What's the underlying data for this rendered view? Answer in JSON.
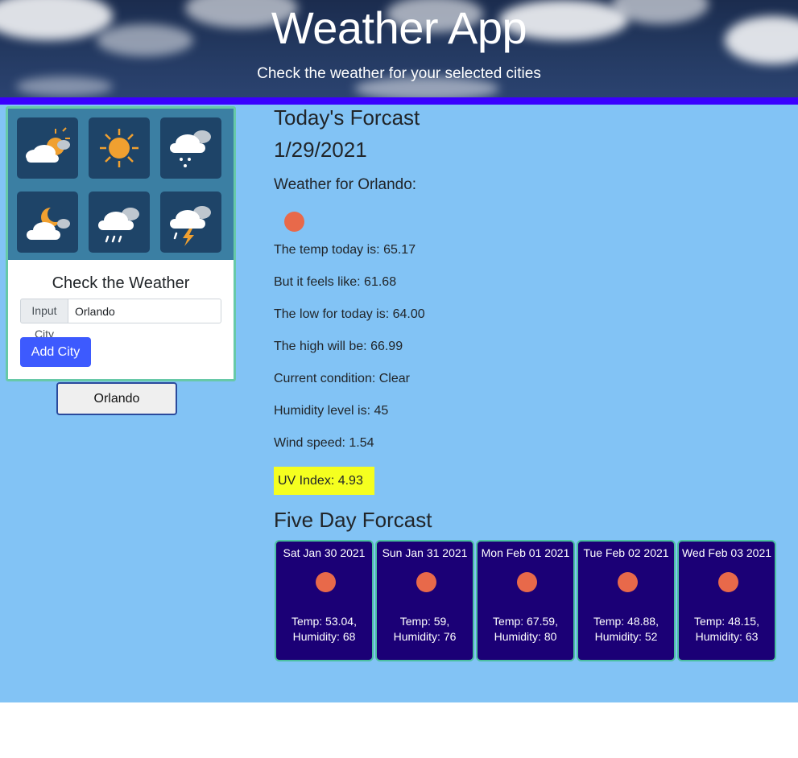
{
  "header": {
    "title": "Weather App",
    "subtitle": "Check the weather for your selected cities"
  },
  "colors": {
    "header_bar": "#3a00ff",
    "main_bg": "#82c3f5",
    "button": "#3d5afe",
    "uv_highlight": "#f5ff1f",
    "forecast_card": "#1b0076",
    "weather_icon": "#e8694a"
  },
  "sidebar": {
    "image_icons": [
      "partly-cloudy-day-icon",
      "sun-icon",
      "snow-cloud-icon",
      "partly-cloudy-night-icon",
      "rain-cloud-icon",
      "thunderstorm-icon"
    ],
    "card_title": "Check the Weather",
    "input_label": "Input City",
    "input_value": "Orlando",
    "add_button": "Add City",
    "saved_cities": [
      "Orlando"
    ]
  },
  "today": {
    "heading": "Today's Forcast",
    "date": "1/29/2021",
    "city_heading": "Weather for Orlando:",
    "icon": "weather-icon",
    "stats": [
      "The temp today is: 65.17",
      "But it feels like: 61.68",
      "The low for today is: 64.00",
      "The high will be: 66.99",
      "Current condition: Clear",
      "Humidity level is: 45",
      "Wind speed: 1.54"
    ],
    "uv_index": "UV Index: 4.93"
  },
  "forecast": {
    "heading": "Five Day Forcast",
    "days": [
      {
        "date": "Sat Jan 30 2021",
        "temp": "Temp: 53.04,",
        "humidity": "Humidity: 68"
      },
      {
        "date": "Sun Jan 31 2021",
        "temp": "Temp: 59,",
        "humidity": "Humidity: 76"
      },
      {
        "date": "Mon Feb 01 2021",
        "temp": "Temp: 67.59,",
        "humidity": "Humidity: 80"
      },
      {
        "date": "Tue Feb 02 2021",
        "temp": "Temp: 48.88,",
        "humidity": "Humidity: 52"
      },
      {
        "date": "Wed Feb 03 2021",
        "temp": "Temp: 48.15,",
        "humidity": "Humidity: 63"
      }
    ]
  }
}
